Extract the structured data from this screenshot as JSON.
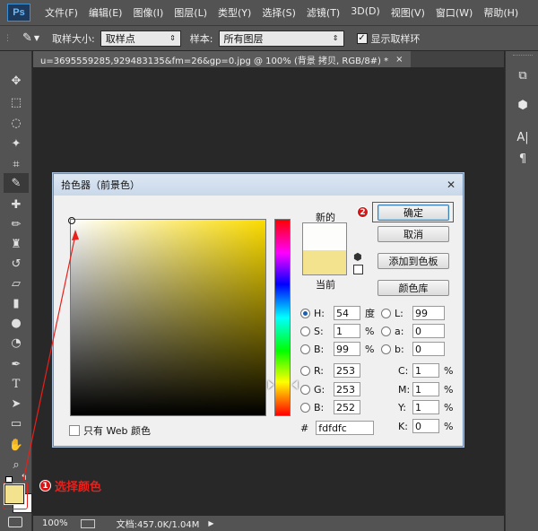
{
  "app": {
    "logo": "Ps"
  },
  "menus": [
    "文件(F)",
    "编辑(E)",
    "图像(I)",
    "图层(L)",
    "类型(Y)",
    "选择(S)",
    "滤镜(T)",
    "3D(D)",
    "视图(V)",
    "窗口(W)",
    "帮助(H)"
  ],
  "options": {
    "sample_size_label": "取样大小:",
    "sample_size_value": "取样点",
    "sample_label": "样本:",
    "sample_value": "所有图层",
    "show_ring_label": "显示取样环",
    "show_ring_checked": true
  },
  "document": {
    "tab_title": "u=3695559285,929483135&fm=26&gp=0.jpg @ 100% (背景 拷贝, RGB/8#) *",
    "tab_close": "×"
  },
  "status": {
    "zoom": "100%",
    "doc_info": "文档:457.0K/1.04M"
  },
  "dialog": {
    "title": "拾色器（前景色）",
    "close": "✕",
    "new_label": "新的",
    "current_label": "当前",
    "web_only_label": "只有 Web 颜色",
    "buttons": {
      "ok": "确定",
      "cancel": "取消",
      "add_swatch": "添加到色板",
      "color_library": "颜色库"
    },
    "hsb": {
      "H": "54",
      "S": "1",
      "B": "99",
      "H_unit": "度",
      "S_unit": "%",
      "B_unit": "%"
    },
    "rgb": {
      "R": "253",
      "G": "253",
      "B": "252"
    },
    "lab": {
      "L": "99",
      "a": "0",
      "b": "0"
    },
    "cmyk": {
      "C": "1",
      "M": "1",
      "Y": "1",
      "K": "0",
      "unit": "%"
    },
    "hex_label": "#",
    "hex": "fdfdfc",
    "new_color": "#fdfdfc",
    "current_color": "#f3e38e"
  },
  "annotations": {
    "step1_number": "1",
    "step1_text": "选择颜色",
    "step2_number": "2"
  },
  "colors": {
    "highlight": "#e8201b",
    "foreground": "#f3e38e",
    "background": "#ffffff"
  }
}
